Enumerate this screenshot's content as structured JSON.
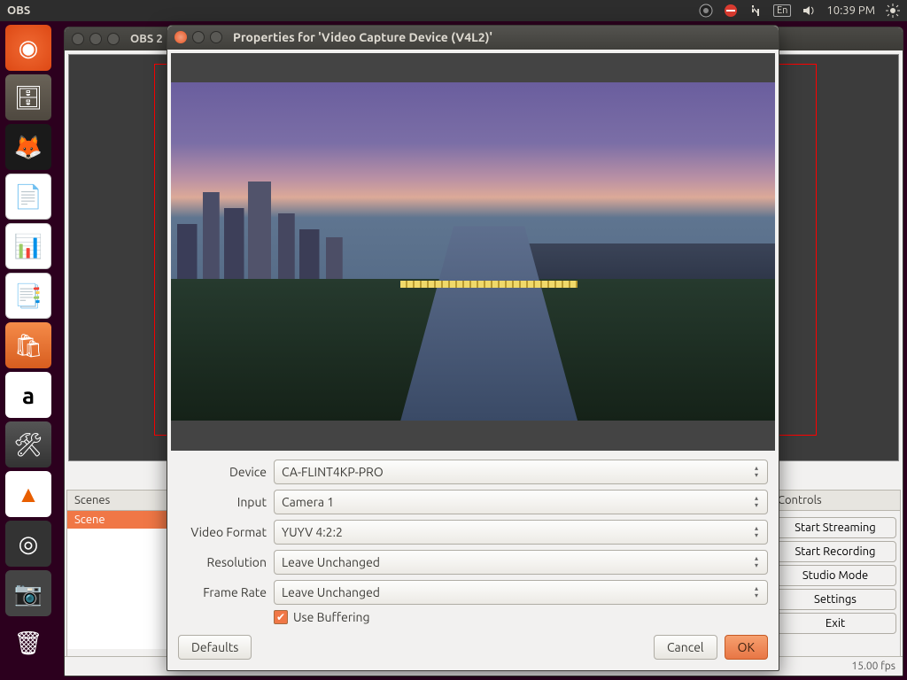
{
  "menubar": {
    "title": "OBS",
    "lang": "En",
    "time": "10:39 PM"
  },
  "launcher": {},
  "obs": {
    "window_title": "OBS 2",
    "panels": {
      "scenes": {
        "header": "Scenes",
        "item": "Scene"
      },
      "controls": {
        "header": "Controls",
        "start_streaming": "Start Streaming",
        "start_recording": "Start Recording",
        "studio_mode": "Studio Mode",
        "settings": "Settings",
        "exit": "Exit"
      }
    },
    "status": {
      "fps": "15.00 fps"
    }
  },
  "dialog": {
    "title": "Properties for 'Video Capture Device (V4L2)'",
    "fields": {
      "device": {
        "label": "Device",
        "value": "CA-FLINT4KP-PRO"
      },
      "input": {
        "label": "Input",
        "value": "Camera 1"
      },
      "video_format": {
        "label": "Video Format",
        "value": "YUYV 4:2:2"
      },
      "resolution": {
        "label": "Resolution",
        "value": "Leave Unchanged"
      },
      "frame_rate": {
        "label": "Frame Rate",
        "value": "Leave Unchanged"
      },
      "use_buffering": {
        "label": "Use Buffering",
        "checked": true
      }
    },
    "buttons": {
      "defaults": "Defaults",
      "cancel": "Cancel",
      "ok": "OK"
    }
  }
}
